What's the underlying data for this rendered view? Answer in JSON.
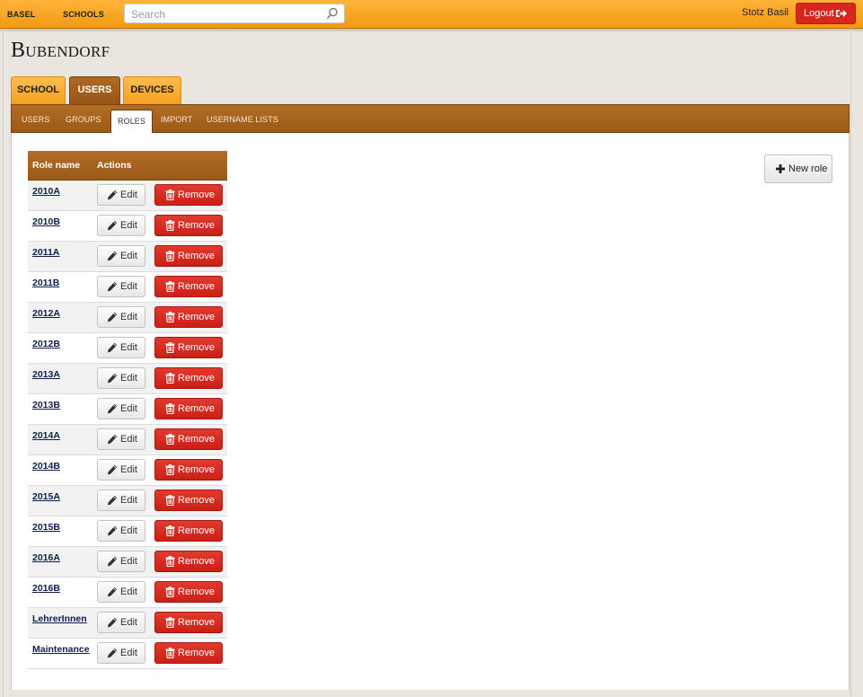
{
  "topbar": {
    "nav": [
      "BASEL",
      "SCHOOLS"
    ],
    "search_placeholder": "Search",
    "user_name": "Stotz Basil",
    "logout_label": "Logout"
  },
  "page": {
    "title": "Bubendorf",
    "tabs": [
      "SCHOOL",
      "USERS",
      "DEVICES"
    ],
    "active_tab": "USERS",
    "subtabs": [
      "USERS",
      "GROUPS",
      "ROLES",
      "IMPORT",
      "USERNAME LISTS"
    ],
    "active_subtab": "ROLES"
  },
  "table": {
    "headers": [
      "Role name",
      "Actions"
    ],
    "edit_label": "Edit",
    "remove_label": "Remove",
    "rows": [
      "2010A",
      "2010B",
      "2011A",
      "2011B",
      "2012A",
      "2012B",
      "2013A",
      "2013B",
      "2014A",
      "2014B",
      "2015A",
      "2015B",
      "2016A",
      "2016B",
      "LehrerInnen",
      "Maintenance"
    ]
  },
  "new_role_label": "New role",
  "colors": {
    "accent_orange": "#f6a020",
    "brown": "#9a5a18",
    "danger": "#d9261c"
  }
}
